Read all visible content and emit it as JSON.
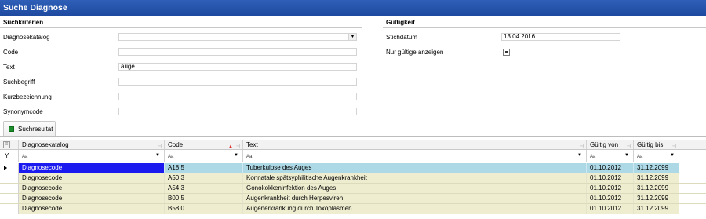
{
  "window": {
    "title": "Suche Diagnose"
  },
  "suchkriterien": {
    "header": "Suchkriterien",
    "fields": [
      {
        "label": "Diagnosekatalog",
        "value": ""
      },
      {
        "label": "Code",
        "value": ""
      },
      {
        "label": "Text",
        "value": "auge"
      },
      {
        "label": "Suchbegriff",
        "value": ""
      },
      {
        "label": "Kurzbezeichnung",
        "value": ""
      },
      {
        "label": "Synonymcode",
        "value": ""
      }
    ]
  },
  "gueltigkeit": {
    "header": "Gültigkeit",
    "stichdatum_label": "Stichdatum",
    "stichdatum_value": "13.04.2016",
    "nur_gueltige_label": "Nur gültige anzeigen",
    "nur_gueltige_checked": true
  },
  "tab": {
    "label": "Suchresultat"
  },
  "grid": {
    "columns": [
      "Diagnosekatalog",
      "Code",
      "Text",
      "Gültig von",
      "Gültig bis"
    ],
    "filter_placeholder": "Aa",
    "rows": [
      {
        "katalog": "Diagnosecode",
        "code": "A18.5",
        "text": "Tuberkulose des Auges",
        "von": "01.10.2012",
        "bis": "31.12.2099",
        "selected": true
      },
      {
        "katalog": "Diagnosecode",
        "code": "A50.3",
        "text": "Konnatale spätsyphilitische Augenkrankheit",
        "von": "01.10.2012",
        "bis": "31.12.2099"
      },
      {
        "katalog": "Diagnosecode",
        "code": "A54.3",
        "text": "Gonokokkeninfektion des Auges",
        "von": "01.10.2012",
        "bis": "31.12.2099"
      },
      {
        "katalog": "Diagnosecode",
        "code": "B00.5",
        "text": "Augenkrankheit durch Herpesviren",
        "von": "01.10.2012",
        "bis": "31.12.2099"
      },
      {
        "katalog": "Diagnosecode",
        "code": "B58.0",
        "text": "Augenerkrankung durch Toxoplasmen",
        "von": "01.10.2012",
        "bis": "31.12.2099"
      }
    ]
  },
  "colors": {
    "titlebar": "#1e4aa0",
    "row_bg": "#eeedd0",
    "selected_row": "#add8e6",
    "selected_cell": "#1b1bf0"
  }
}
